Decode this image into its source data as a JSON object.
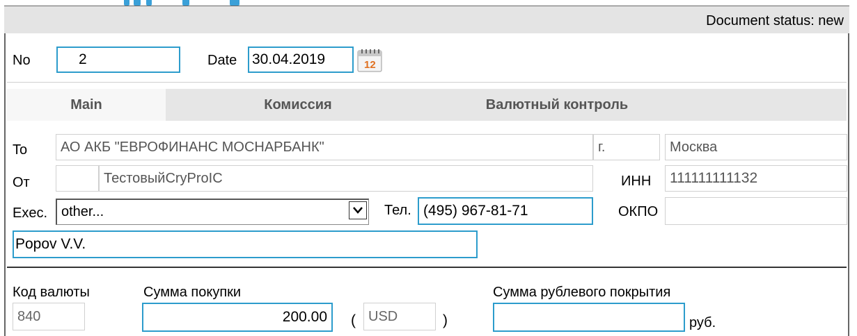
{
  "header": {
    "status_text": "Document status: new"
  },
  "doc": {
    "no_label": "No",
    "no_value": "2",
    "date_label": "Date",
    "date_value": "30.04.2019",
    "calendar_day": "12"
  },
  "tabs": [
    {
      "label": "Main",
      "active": true
    },
    {
      "label": "Комиссия",
      "active": false
    },
    {
      "label": "Валютный контроль",
      "active": false
    }
  ],
  "main": {
    "to_label": "To",
    "to_value": "АО АКБ \"ЕВРОФИНАНС МОСНАРБАНК\"",
    "city_label": "г.",
    "city_value": "Москва",
    "from_label": "От",
    "from_code": "",
    "from_value": "ТестовыйCryProIC",
    "inn_label": "ИНН",
    "inn_value": "111111111132",
    "exec_label": "Exec.",
    "exec_value": "other...",
    "tel_label": "Тел.",
    "tel_value": "(495) 967-81-71",
    "okpo_label": "ОКПО",
    "okpo_value": "",
    "exec_name_value": "Popov V.V."
  },
  "amounts": {
    "currency_code_label": "Код валюты",
    "currency_code_value": "840",
    "purchase_label": "Сумма покупки",
    "purchase_value": "200.00",
    "paren_open": "(",
    "currency_value": "USD",
    "paren_close": ")",
    "rub_cover_label": "Сумма рублевого покрытия",
    "rub_cover_value": "",
    "rub_unit": "руб."
  },
  "colors": {
    "accent": "#2c9ccc",
    "status_bar": "#e4e4e4",
    "tabbar": "#e6e6e6"
  }
}
